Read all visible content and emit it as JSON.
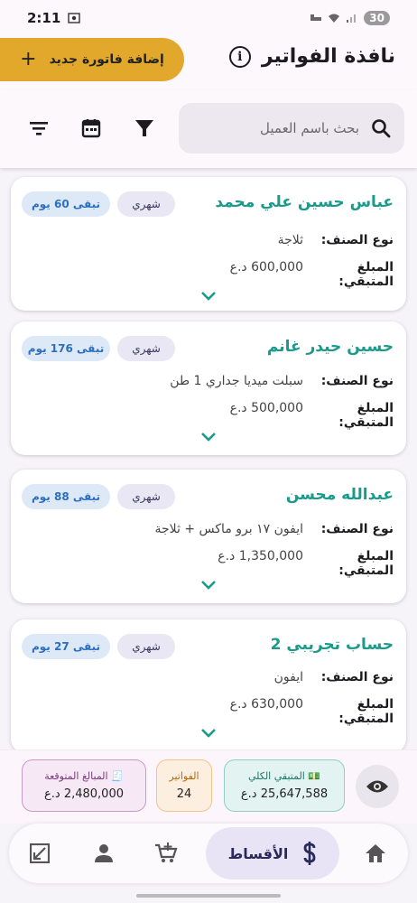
{
  "status_bar": {
    "time": "2:11",
    "battery": "30"
  },
  "header": {
    "title": "نافذة الفواتير",
    "add_button_label": "إضافة فاتورة جديد"
  },
  "search": {
    "placeholder": "بحث باسم العميل"
  },
  "labels": {
    "item_type": "نوع الصنف:",
    "remaining_amount": "المبلغ المتبقي:"
  },
  "cards": [
    {
      "name": "عباس حسين علي محمد",
      "type": "شهري",
      "days_left": "تبقى 60 يوم",
      "item": "ثلاجة",
      "amount": "600,000 د.ع"
    },
    {
      "name": "حسين حيدر غانم",
      "type": "شهري",
      "days_left": "تبقى 176 يوم",
      "item": "سبلت ميديا جداري 1 طن",
      "amount": "500,000 د.ع"
    },
    {
      "name": "عبدالله محسن",
      "type": "شهري",
      "days_left": "تبقى 88 يوم",
      "item": "ايفون ١٧ برو ماكس + ثلاجة",
      "amount": "1,350,000 د.ع"
    },
    {
      "name": "حساب تجريبي 2",
      "type": "شهري",
      "days_left": "تبقى 27 يوم",
      "item": "ايفون",
      "amount": "630,000 د.ع"
    }
  ],
  "summary": {
    "total_remaining_label": "💵 المتبقي الكلي",
    "total_remaining_value": "25,647,588 د.ع",
    "invoices_label": "الفواتير",
    "invoices_value": "24",
    "expected_label": "🧾 المبالغ المتوقعة",
    "expected_value": "2,480,000 د.ع"
  },
  "nav": {
    "active_label": "الأقساط"
  },
  "colors": {
    "accent": "#e2a82c",
    "name_teal": "#1a9a8a",
    "days_chip_text": "#2c6fbf"
  },
  "icons": [
    "search-icon",
    "filter-icon",
    "calendar-icon",
    "sort-icon",
    "info-icon",
    "eye-icon",
    "home-icon",
    "dollar-icon",
    "cart-add-icon",
    "person-icon",
    "resize-icon",
    "chevron-down-icon"
  ]
}
